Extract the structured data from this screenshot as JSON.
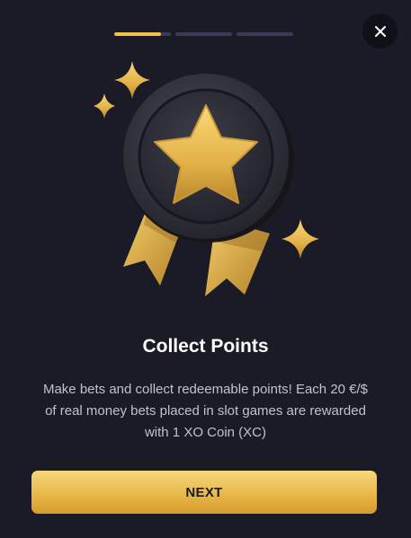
{
  "progress": {
    "steps": 3,
    "current_step": 1,
    "current_step_fill": 0.82
  },
  "close": {
    "icon": "close-icon"
  },
  "illustration": {
    "icon": "star-medal-icon"
  },
  "content": {
    "title": "Collect Points",
    "description": "Make bets and collect redeemable points! Each 20 €/$ of real money bets placed in slot games are rewarded with 1 XO Coin (XC)"
  },
  "actions": {
    "next_label": "NEXT"
  },
  "colors": {
    "background": "#1b1b28",
    "accent": "#f2c14e",
    "inactive_step": "#3b3b58"
  }
}
